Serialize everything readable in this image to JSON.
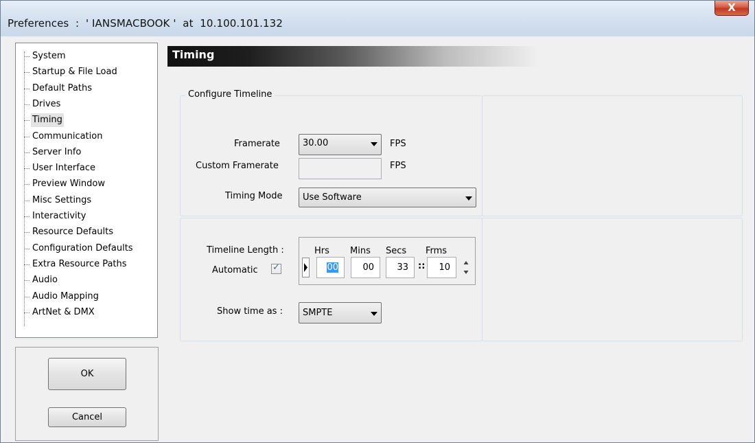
{
  "window": {
    "title": "Preferences  :  ' IANSMACBOOK '  at  10.100.101.132",
    "close_glyph": "X"
  },
  "sidebar": {
    "items": [
      {
        "label": "System"
      },
      {
        "label": "Startup & File Load"
      },
      {
        "label": "Default Paths"
      },
      {
        "label": "Drives"
      },
      {
        "label": "Timing",
        "selected": true
      },
      {
        "label": "Communication"
      },
      {
        "label": "Server Info"
      },
      {
        "label": "User Interface"
      },
      {
        "label": "Preview Window"
      },
      {
        "label": "Misc Settings"
      },
      {
        "label": "Interactivity"
      },
      {
        "label": "Resource Defaults"
      },
      {
        "label": "Configuration Defaults"
      },
      {
        "label": "Extra Resource Paths"
      },
      {
        "label": "Audio"
      },
      {
        "label": "Audio Mapping"
      },
      {
        "label": "ArtNet & DMX"
      }
    ]
  },
  "buttons": {
    "ok_label": "OK",
    "cancel_label": "Cancel"
  },
  "section": {
    "title": "Timing"
  },
  "configure_timeline": {
    "legend": "Configure Timeline",
    "framerate_label": "Framerate",
    "framerate_value": "30.00",
    "framerate_unit": "FPS",
    "custom_framerate_label": "Custom Framerate",
    "custom_framerate_value": "",
    "custom_framerate_unit": "FPS",
    "timing_mode_label": "Timing Mode",
    "timing_mode_value": "Use Software"
  },
  "timeline": {
    "length_label": "Timeline Length :",
    "automatic_label": "Automatic",
    "automatic_checked": true,
    "check_glyph": "✓",
    "headers": {
      "hrs": "Hrs",
      "mins": "Mins",
      "secs": "Secs",
      "frms": "Frms"
    },
    "hrs": "00",
    "mins": "00",
    "secs": "33",
    "frms": "10",
    "separator": "::",
    "show_time_label": "Show time as :",
    "show_time_value": "SMPTE"
  },
  "colors": {
    "selection": "#3399ff",
    "close_button": "#c2371f",
    "header_bar": "#111111"
  }
}
